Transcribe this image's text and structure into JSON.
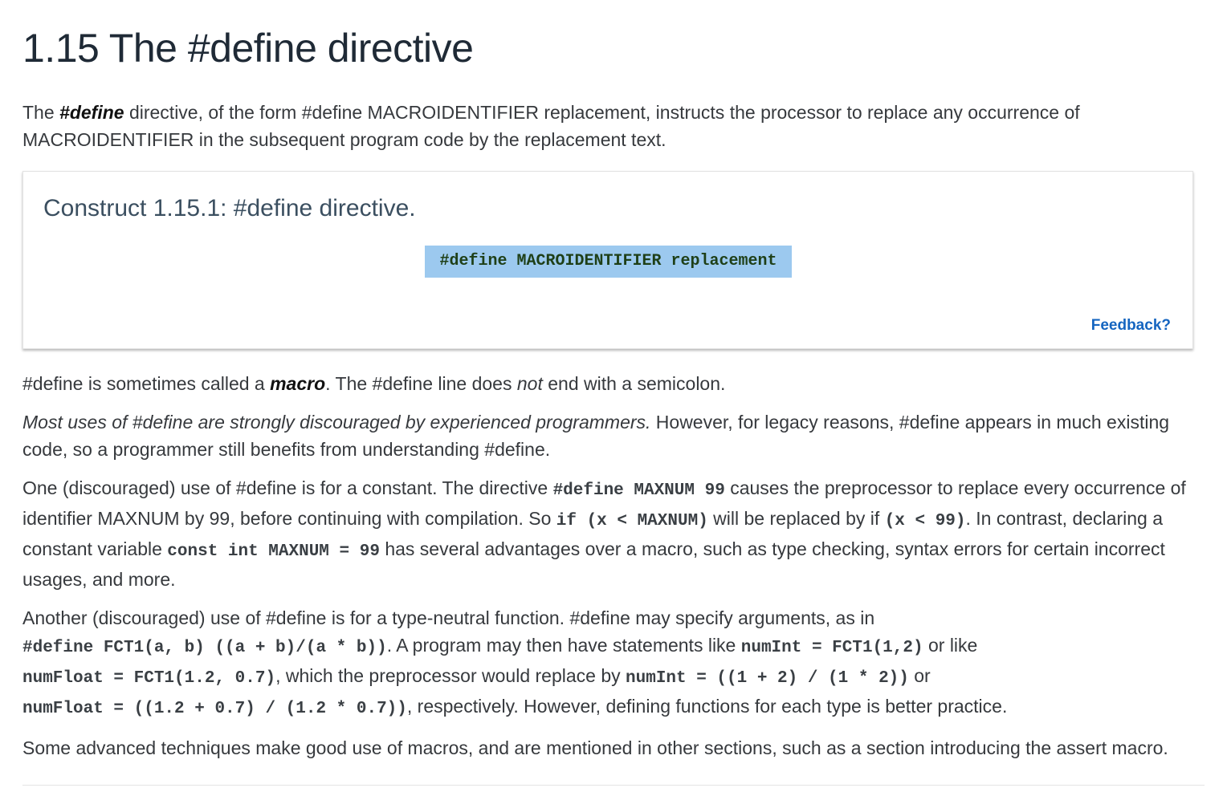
{
  "section": {
    "title": "1.15 The #define directive"
  },
  "intro": {
    "text_before": "The ",
    "keyword": "#define",
    "text_after": " directive, of the form #define MACROIDENTIFIER replacement, instructs the processor to replace any occurrence of MACROIDENTIFIER in the subsequent program code by the replacement text."
  },
  "construct": {
    "title": "Construct 1.15.1: #define directive.",
    "code": "#define MACROIDENTIFIER replacement",
    "feedback_label": "Feedback?",
    "code_highlight_color": "#9cc9ef",
    "feedback_color": "#1565c0"
  },
  "p1": {
    "t1": "#define is sometimes called a ",
    "macro": "macro",
    "t2": ". The #define line does ",
    "not": "not",
    "t3": " end with a semicolon."
  },
  "p2": {
    "italic": "Most uses of #define are strongly discouraged by experienced programmers.",
    "rest": " However, for legacy reasons, #define appears in much existing code, so a programmer still benefits from understanding #define."
  },
  "p3": {
    "t1": "One (discouraged) use of #define is for a constant. The directive ",
    "c1": "#define MAXNUM 99",
    "t2": " causes the preprocessor to replace every occurrence of identifier MAXNUM by 99, before continuing with compilation. So ",
    "c2": "if (x < MAXNUM)",
    "t3": " will be replaced by if ",
    "c3": "(x < 99)",
    "t4": ". In contrast, declaring a constant variable ",
    "c4": "const int MAXNUM = 99",
    "t5": " has several advantages over a macro, such as type checking, syntax errors for certain incorrect usages, and more."
  },
  "p4": {
    "t1": "Another (discouraged) use of #define is for a type-neutral function. #define may specify arguments, as in",
    "c1": "#define FCT1(a, b) ((a + b)/(a * b))",
    "t2": ". A program may then have statements like ",
    "c2": "numInt = FCT1(1,2)",
    "t3": " or like",
    "c3": "numFloat = FCT1(1.2, 0.7)",
    "t4": ", which the preprocessor would replace by ",
    "c4": "numInt = ((1 + 2) / (1 * 2))",
    "t5": " or",
    "c5": "numFloat = ((1.2 + 0.7) / (1.2 * 0.7))",
    "t6": ", respectively. However, defining functions for each type is better practice."
  },
  "p5": {
    "text": "Some advanced techniques make good use of macros, and are mentioned in other sections, such as a section introducing the assert macro."
  }
}
